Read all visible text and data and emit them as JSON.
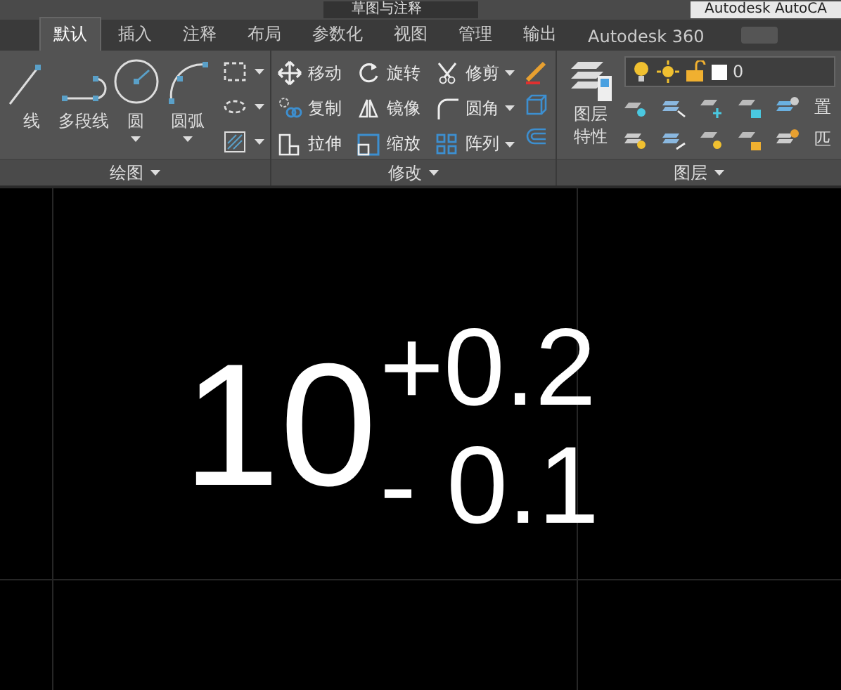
{
  "title_bar": {
    "workspace": "草图与注释",
    "app_title": "Autodesk AutoCA"
  },
  "tabs": [
    {
      "label": "默认",
      "selected": true
    },
    {
      "label": "插入",
      "selected": false
    },
    {
      "label": "注释",
      "selected": false
    },
    {
      "label": "布局",
      "selected": false
    },
    {
      "label": "参数化",
      "selected": false
    },
    {
      "label": "视图",
      "selected": false
    },
    {
      "label": "管理",
      "selected": false
    },
    {
      "label": "输出",
      "selected": false
    },
    {
      "label": "Autodesk 360",
      "selected": false
    }
  ],
  "draw_panel": {
    "title": "绘图",
    "tools": [
      "线",
      "多段线",
      "圆",
      "圆弧"
    ]
  },
  "modify_panel": {
    "title": "修改",
    "tools": [
      {
        "label": "移动",
        "dropdown": false
      },
      {
        "label": "旋转",
        "dropdown": false
      },
      {
        "label": "修剪",
        "dropdown": true
      },
      {
        "label": "复制",
        "dropdown": false
      },
      {
        "label": "镜像",
        "dropdown": false
      },
      {
        "label": "圆角",
        "dropdown": true
      },
      {
        "label": "拉伸",
        "dropdown": false
      },
      {
        "label": "缩放",
        "dropdown": false
      },
      {
        "label": "阵列",
        "dropdown": true
      }
    ]
  },
  "layer_panel": {
    "title": "图层",
    "properties_button": "图层特性",
    "current_layer": "0",
    "row_labels": [
      "置",
      "匹"
    ]
  },
  "drawing": {
    "base_value": "10",
    "upper_tolerance": "+0.2",
    "lower_tolerance": "- 0.1"
  }
}
